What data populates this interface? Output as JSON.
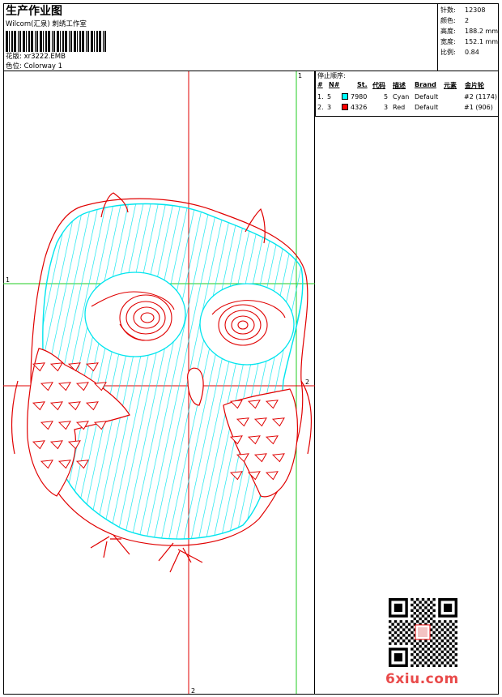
{
  "header": {
    "title": "生产作业图",
    "company": "Wilcom(汇泉) 刺绣工作室",
    "design_label": "花版: ",
    "design_value": "xr3222.EMB",
    "colorway_label": "色位: ",
    "colorway_value": "Colorway 1"
  },
  "stats": [
    {
      "label": "针数:",
      "value": "12308"
    },
    {
      "label": "颜色:",
      "value": "2"
    },
    {
      "label": "高度:",
      "value": "188.2 mm"
    },
    {
      "label": "宽度:",
      "value": "152.1 mm"
    },
    {
      "label": "比例:",
      "value": "0.84"
    }
  ],
  "stop_sequence": {
    "title": "停止顺序:",
    "headers": [
      "#",
      "N#",
      "St.",
      "代码",
      "描述",
      "Brand",
      "元素",
      "金片轮"
    ],
    "rows": [
      {
        "idx": "1.",
        "n": "5",
        "color": "#00ffff",
        "st": "7980",
        "code": "5",
        "desc": "Cyan",
        "brand": "Default",
        "elem": "",
        "seq": "#2 (1174)"
      },
      {
        "idx": "2.",
        "n": "3",
        "color": "#ff0000",
        "st": "4326",
        "code": "3",
        "desc": "Red",
        "brand": "Default",
        "elem": "",
        "seq": "#1 (906)"
      }
    ]
  },
  "guides": {
    "v_red_top": "",
    "v_green_top": "1",
    "h_green_left": "1",
    "h_red_right": "2",
    "v_red_bottom": "2"
  },
  "watermark": {
    "text": "6xiu.com"
  },
  "colors": {
    "cyan": "#00e5ee",
    "red": "#e00000",
    "green": "#22cc22"
  }
}
